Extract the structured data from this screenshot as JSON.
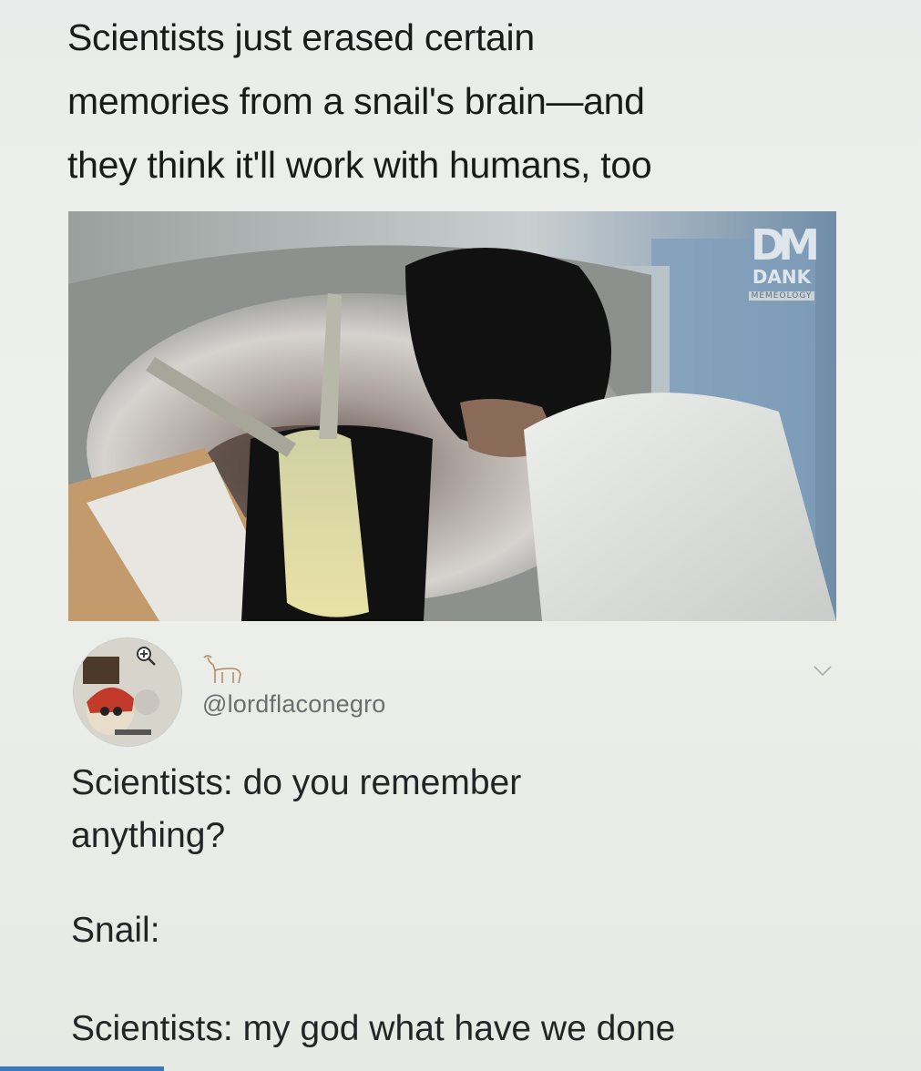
{
  "headline": {
    "lines": [
      "Scientists just erased certain",
      "memories from a snail's brain—and",
      "they think it'll work with humans, too"
    ]
  },
  "image": {
    "watermark": {
      "logo": "DM",
      "title": "DANK",
      "subtitle": "MEMEOLOGY"
    }
  },
  "tweet": {
    "handle": "@lordflaconegro",
    "icons": {
      "zoom": "zoom-in-icon",
      "goat": "goat-emoji-icon",
      "menu": "chevron-down-icon"
    },
    "lines": [
      "Scientists: do you remember",
      "anything?",
      "Snail:",
      "Scientists: my god what have we done"
    ]
  },
  "colors": {
    "page_bg": "#eceee9",
    "text": "#1b1d1f",
    "handle": "#6a6e70"
  }
}
